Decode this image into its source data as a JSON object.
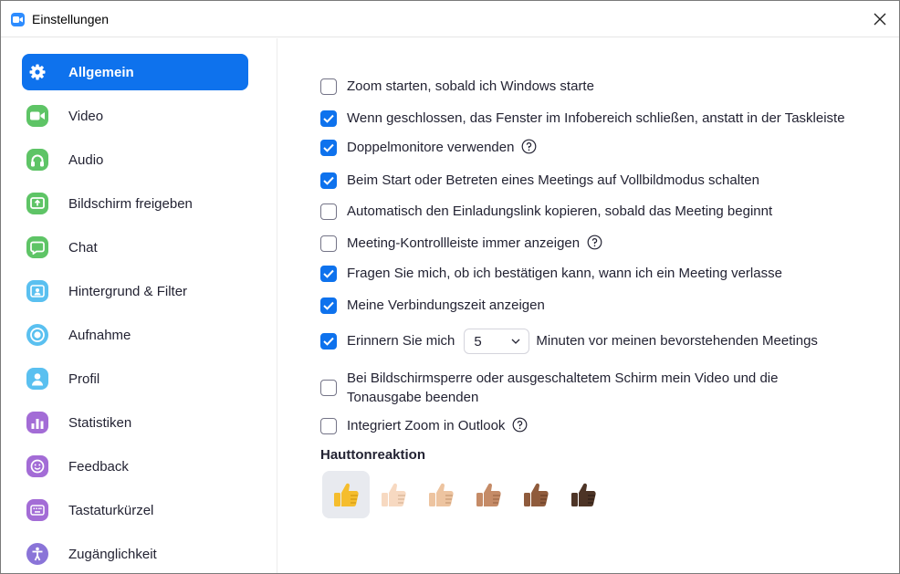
{
  "window": {
    "title": "Einstellungen"
  },
  "sidebar": {
    "items": [
      {
        "label": "Allgemein",
        "icon": "gear-icon",
        "color": "#0e72ed",
        "active": true
      },
      {
        "label": "Video",
        "icon": "video-camera-icon",
        "color": "#5ec466"
      },
      {
        "label": "Audio",
        "icon": "headphones-icon",
        "color": "#5ec466"
      },
      {
        "label": "Bildschirm freigeben",
        "icon": "share-screen-icon",
        "color": "#5ec466"
      },
      {
        "label": "Chat",
        "icon": "chat-bubble-icon",
        "color": "#5ec466"
      },
      {
        "label": "Hintergrund & Filter",
        "icon": "background-person-icon",
        "color": "#5ac0f0"
      },
      {
        "label": "Aufnahme",
        "icon": "record-icon",
        "color": "#5ac0f0"
      },
      {
        "label": "Profil",
        "icon": "profile-person-icon",
        "color": "#5ac0f0"
      },
      {
        "label": "Statistiken",
        "icon": "bar-chart-icon",
        "color": "#a36cd6"
      },
      {
        "label": "Feedback",
        "icon": "smiley-face-icon",
        "color": "#a36cd6"
      },
      {
        "label": "Tastaturkürzel",
        "icon": "keyboard-icon",
        "color": "#a36cd6"
      },
      {
        "label": "Zugänglichkeit",
        "icon": "accessibility-person-icon",
        "color": "#8a74d8"
      }
    ]
  },
  "general": {
    "options": [
      {
        "label": "Zoom starten, sobald ich Windows starte",
        "checked": false
      },
      {
        "label": "Wenn geschlossen, das Fenster im Infobereich schließen, anstatt in der Taskleiste",
        "checked": true
      },
      {
        "label": "Doppelmonitore verwenden",
        "checked": true,
        "help": true
      },
      {
        "label": "Beim Start oder Betreten eines Meetings auf Vollbildmodus schalten",
        "checked": true
      },
      {
        "label": "Automatisch den Einladungslink kopieren, sobald das Meeting beginnt",
        "checked": false
      },
      {
        "label": "Meeting-Kontrollleiste immer anzeigen",
        "checked": false,
        "help": true
      },
      {
        "label": "Fragen Sie mich, ob ich bestätigen kann, wann ich ein Meeting verlasse",
        "checked": true
      },
      {
        "label": "Meine Verbindungszeit anzeigen",
        "checked": true
      }
    ],
    "reminder": {
      "prefix": "Erinnern Sie mich",
      "value": "5",
      "suffix": "Minuten vor meinen bevorstehenden Meetings",
      "checked": true
    },
    "lock_option": {
      "line1": "Bei Bildschirmsperre oder ausgeschaltetem Schirm mein Video und die",
      "line2": "Tonausgabe beenden",
      "checked": false
    },
    "outlook_option": {
      "label": "Integriert Zoom in Outlook",
      "checked": false,
      "help": true
    },
    "skin_tone": {
      "title": "Hauttonreaktion",
      "tones": [
        "#f5bd2d",
        "#f7d9c1",
        "#edc4a0",
        "#c58b67",
        "#8f5b3c",
        "#4d3426"
      ],
      "selected": 0
    }
  }
}
